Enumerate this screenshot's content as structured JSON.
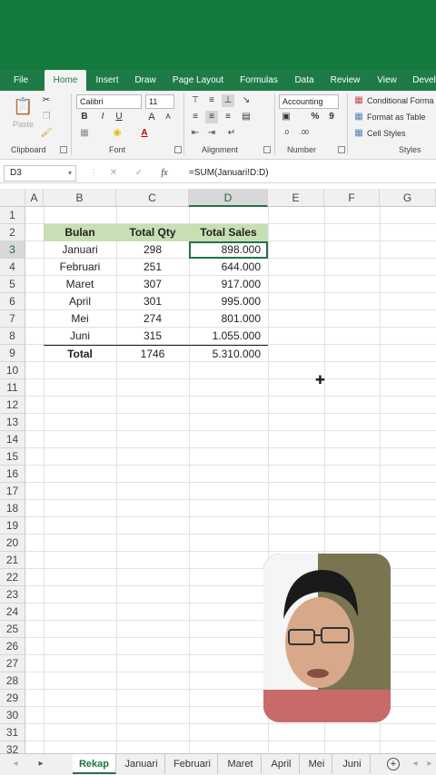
{
  "ribbon_tabs": [
    "File",
    "Home",
    "Insert",
    "Draw",
    "Page Layout",
    "Formulas",
    "Data",
    "Review",
    "View",
    "Devel"
  ],
  "active_tab": "Home",
  "clipboard": {
    "paste_label": "Paste",
    "group_label": "Clipboard"
  },
  "font": {
    "name": "Calibri",
    "size": "11",
    "group_label": "Font",
    "bold": "B",
    "italic": "I",
    "underline": "U",
    "grow": "A",
    "shrink": "A",
    "color_glyph": "A"
  },
  "alignment": {
    "group_label": "Alignment"
  },
  "number": {
    "format": "Accounting",
    "percent": "%",
    "comma": "9",
    "group_label": "Number"
  },
  "styles": {
    "conditional": "Conditional Forma",
    "format_table": "Format as Table",
    "cell_styles": "Cell Styles",
    "group_label": "Styles"
  },
  "formula_bar": {
    "name_box": "D3",
    "fx": "fx",
    "formula": "=SUM(Januari!D:D)"
  },
  "columns": [
    "A",
    "B",
    "C",
    "D",
    "E",
    "F",
    "G"
  ],
  "selected_column": "D",
  "selected_row": "3",
  "rows": [
    "1",
    "2",
    "3",
    "4",
    "5",
    "6",
    "7",
    "8",
    "9",
    "10",
    "11",
    "12",
    "13",
    "14",
    "15",
    "16",
    "17",
    "18",
    "19",
    "20",
    "21",
    "22",
    "23",
    "24",
    "25",
    "26",
    "27",
    "28",
    "29",
    "30",
    "31",
    "32"
  ],
  "table": {
    "headers": [
      "Bulan",
      "Total Qty",
      "Total Sales"
    ],
    "data": [
      [
        "Januari",
        "298",
        "898.000"
      ],
      [
        "Februari",
        "251",
        "644.000"
      ],
      [
        "Maret",
        "307",
        "917.000"
      ],
      [
        "April",
        "301",
        "995.000"
      ],
      [
        "Mei",
        "274",
        "801.000"
      ],
      [
        "Juni",
        "315",
        "1.055.000"
      ]
    ],
    "total": [
      "Total",
      "1746",
      "5.310.000"
    ]
  },
  "sheets": [
    "Rekap",
    "Januari",
    "Februari",
    "Maret",
    "April",
    "Mei",
    "Juni"
  ],
  "active_sheet": "Rekap",
  "colors": {
    "excel_green": "#217346",
    "titlebar": "#157a3d",
    "header_fill": "#c6e0b4"
  }
}
